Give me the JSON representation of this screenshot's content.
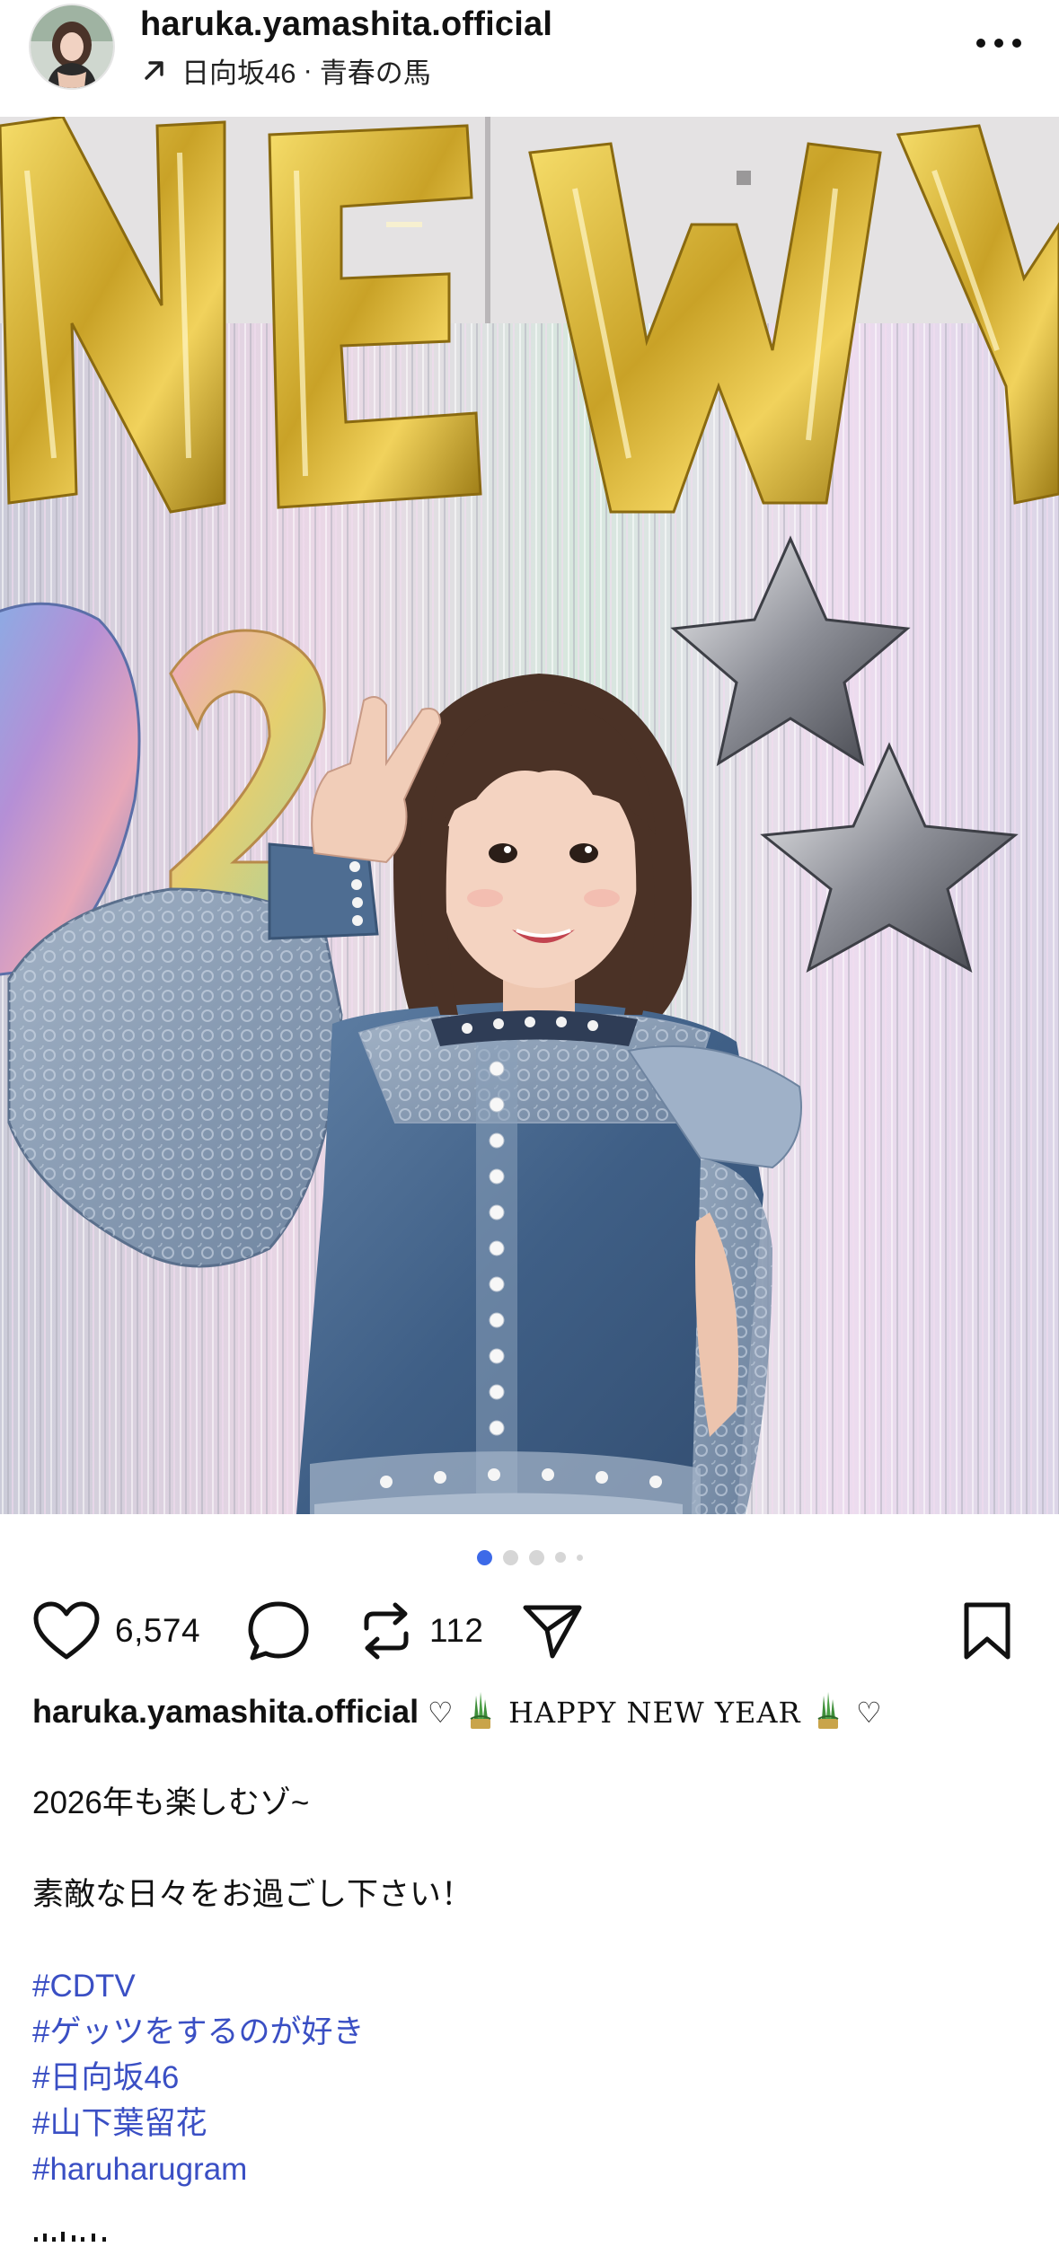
{
  "header": {
    "username": "haruka.yamashita.official",
    "subline": {
      "arrow_icon": "arrow-up-right-icon",
      "part1": "日向坂46",
      "separator": "·",
      "part2": "青春の馬"
    },
    "more_icon": "more-horizontal-icon"
  },
  "media": {
    "balloon_text": "NEW Y",
    "balloon_digits": "2",
    "mute_icon": "speaker-muted-icon",
    "carousel": {
      "total_dots": 5,
      "active_index": 0
    }
  },
  "actions": {
    "like_icon": "heart-icon",
    "like_count": "6,574",
    "comment_icon": "comment-bubble-icon",
    "repost_icon": "repost-icon",
    "repost_count": "112",
    "share_icon": "send-icon",
    "save_icon": "bookmark-icon"
  },
  "caption": {
    "author": "haruka.yamashita.official",
    "heart_glyph": "♡",
    "headline": "HAPPY NEW YEAR",
    "line2": "2026年も楽しむゾ~",
    "line3": "素敵な日々をお過ごし下さい！",
    "hashtags": [
      "#CDTV",
      "#ゲッツをするのが好き",
      "#日向坂46",
      "#山下葉留花",
      "#haruharugram"
    ]
  },
  "colors": {
    "accent_blue": "#3d6ae8",
    "hashtag": "#3a4fc4",
    "text": "#111111"
  }
}
